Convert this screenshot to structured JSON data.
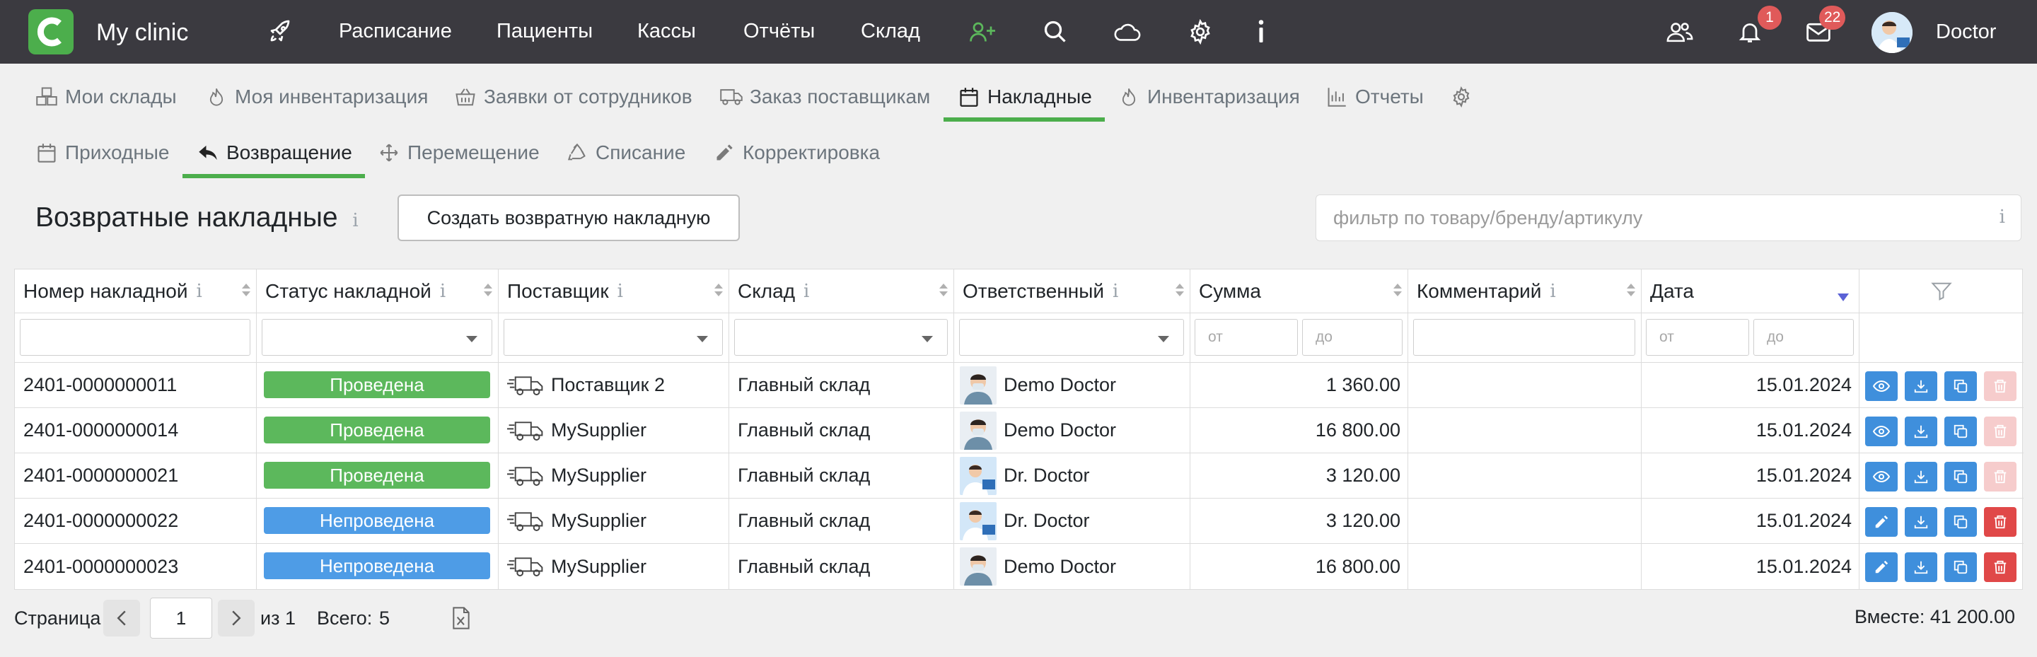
{
  "topbar": {
    "app_title": "My clinic",
    "nav": [
      "Расписание",
      "Пациенты",
      "Кассы",
      "Отчёты",
      "Склад"
    ],
    "notifications_count": "1",
    "messages_count": "22",
    "user_name": "Doctor",
    "icons": [
      "rocket-icon",
      "add-user-icon",
      "search-icon",
      "cloud-icon",
      "gear-icon",
      "info-icon",
      "users-icon",
      "bell-icon",
      "mail-icon"
    ]
  },
  "subnav": {
    "tabs": [
      "Мои склады",
      "Моя инвентаризация",
      "Заявки от сотрудников",
      "Заказ поставщикам",
      "Накладные",
      "Инвентаризация",
      "Отчеты"
    ],
    "active_tab": "Накладные"
  },
  "invoice_tabs": {
    "tabs": [
      "Приходные",
      "Возвращение",
      "Перемещение",
      "Списание",
      "Корректировка"
    ],
    "active_tab": "Возвращение"
  },
  "page": {
    "title": "Возвратные накладные",
    "info_mark": "i",
    "create_button": "Создать возвратную накладную",
    "search_placeholder": "фильтр по товару/бренду/артикулу"
  },
  "table": {
    "columns": [
      "Номер накладной",
      "Статус накладной",
      "Поставщик",
      "Склад",
      "Ответственный",
      "Сумма",
      "Комментарий",
      "Дата"
    ],
    "sorted_column": "Дата",
    "range_from_placeholder": "от",
    "range_to_placeholder": "до",
    "rows": [
      {
        "number": "2401-0000000011",
        "status": "Проведена",
        "supplier": "Поставщик 2",
        "warehouse": "Главный склад",
        "responsible": "Demo Doctor",
        "sum": "1 360.00",
        "comment": "",
        "date": "15.01.2024"
      },
      {
        "number": "2401-0000000014",
        "status": "Проведена",
        "supplier": "MySupplier",
        "warehouse": "Главный склад",
        "responsible": "Demo Doctor",
        "sum": "16 800.00",
        "comment": "",
        "date": "15.01.2024"
      },
      {
        "number": "2401-0000000021",
        "status": "Проведена",
        "supplier": "MySupplier",
        "warehouse": "Главный склад",
        "responsible": "Dr. Doctor",
        "sum": "3 120.00",
        "comment": "",
        "date": "15.01.2024"
      },
      {
        "number": "2401-0000000022",
        "status": "Непроведена",
        "supplier": "MySupplier",
        "warehouse": "Главный склад",
        "responsible": "Dr. Doctor",
        "sum": "3 120.00",
        "comment": "",
        "date": "15.01.2024"
      },
      {
        "number": "2401-0000000023",
        "status": "Непроведена",
        "supplier": "MySupplier",
        "warehouse": "Главный склад",
        "responsible": "Demo Doctor",
        "sum": "16 800.00",
        "comment": "",
        "date": "15.01.2024"
      }
    ]
  },
  "footer": {
    "page_label": "Страница",
    "page_value": "1",
    "of_label": "из 1",
    "total_label": "Всего:",
    "total_value": "5",
    "sum_label": "Вместе: 41 200.00"
  },
  "colors": {
    "topbar": "#3b3a40",
    "accent_green": "#4cae4c",
    "status_done": "#5cb85c",
    "status_draft": "#4e9ce6",
    "action_blue": "#3f8fdc",
    "action_red": "#e04848",
    "sort_active": "#5b62d6"
  }
}
